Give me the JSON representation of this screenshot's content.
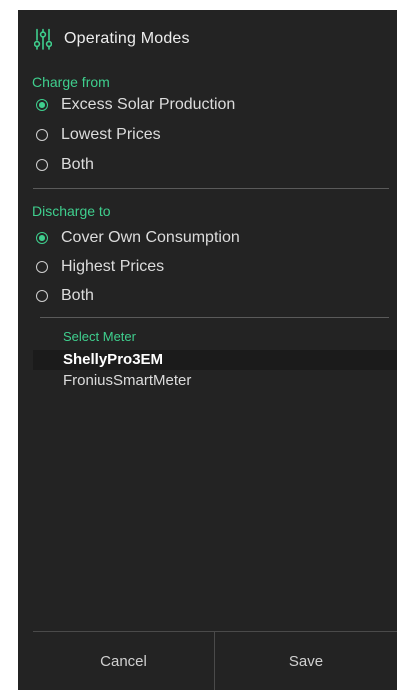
{
  "dialog": {
    "title": "Operating Modes",
    "icon": "sliders-icon",
    "accent_color": "#3fcf8e"
  },
  "charge": {
    "label": "Charge from",
    "options": [
      {
        "label": "Excess Solar Production",
        "checked": true
      },
      {
        "label": "Lowest Prices",
        "checked": false
      },
      {
        "label": "Both",
        "checked": false
      }
    ]
  },
  "discharge": {
    "label": "Discharge to",
    "options": [
      {
        "label": "Cover Own Consumption",
        "checked": true
      },
      {
        "label": "Highest Prices",
        "checked": false
      },
      {
        "label": "Both",
        "checked": false
      }
    ]
  },
  "meter": {
    "label": "Select Meter",
    "items": [
      {
        "label": "ShellyPro3EM",
        "selected": true
      },
      {
        "label": "FroniusSmartMeter",
        "selected": false
      }
    ]
  },
  "footer": {
    "cancel_label": "Cancel",
    "save_label": "Save"
  }
}
